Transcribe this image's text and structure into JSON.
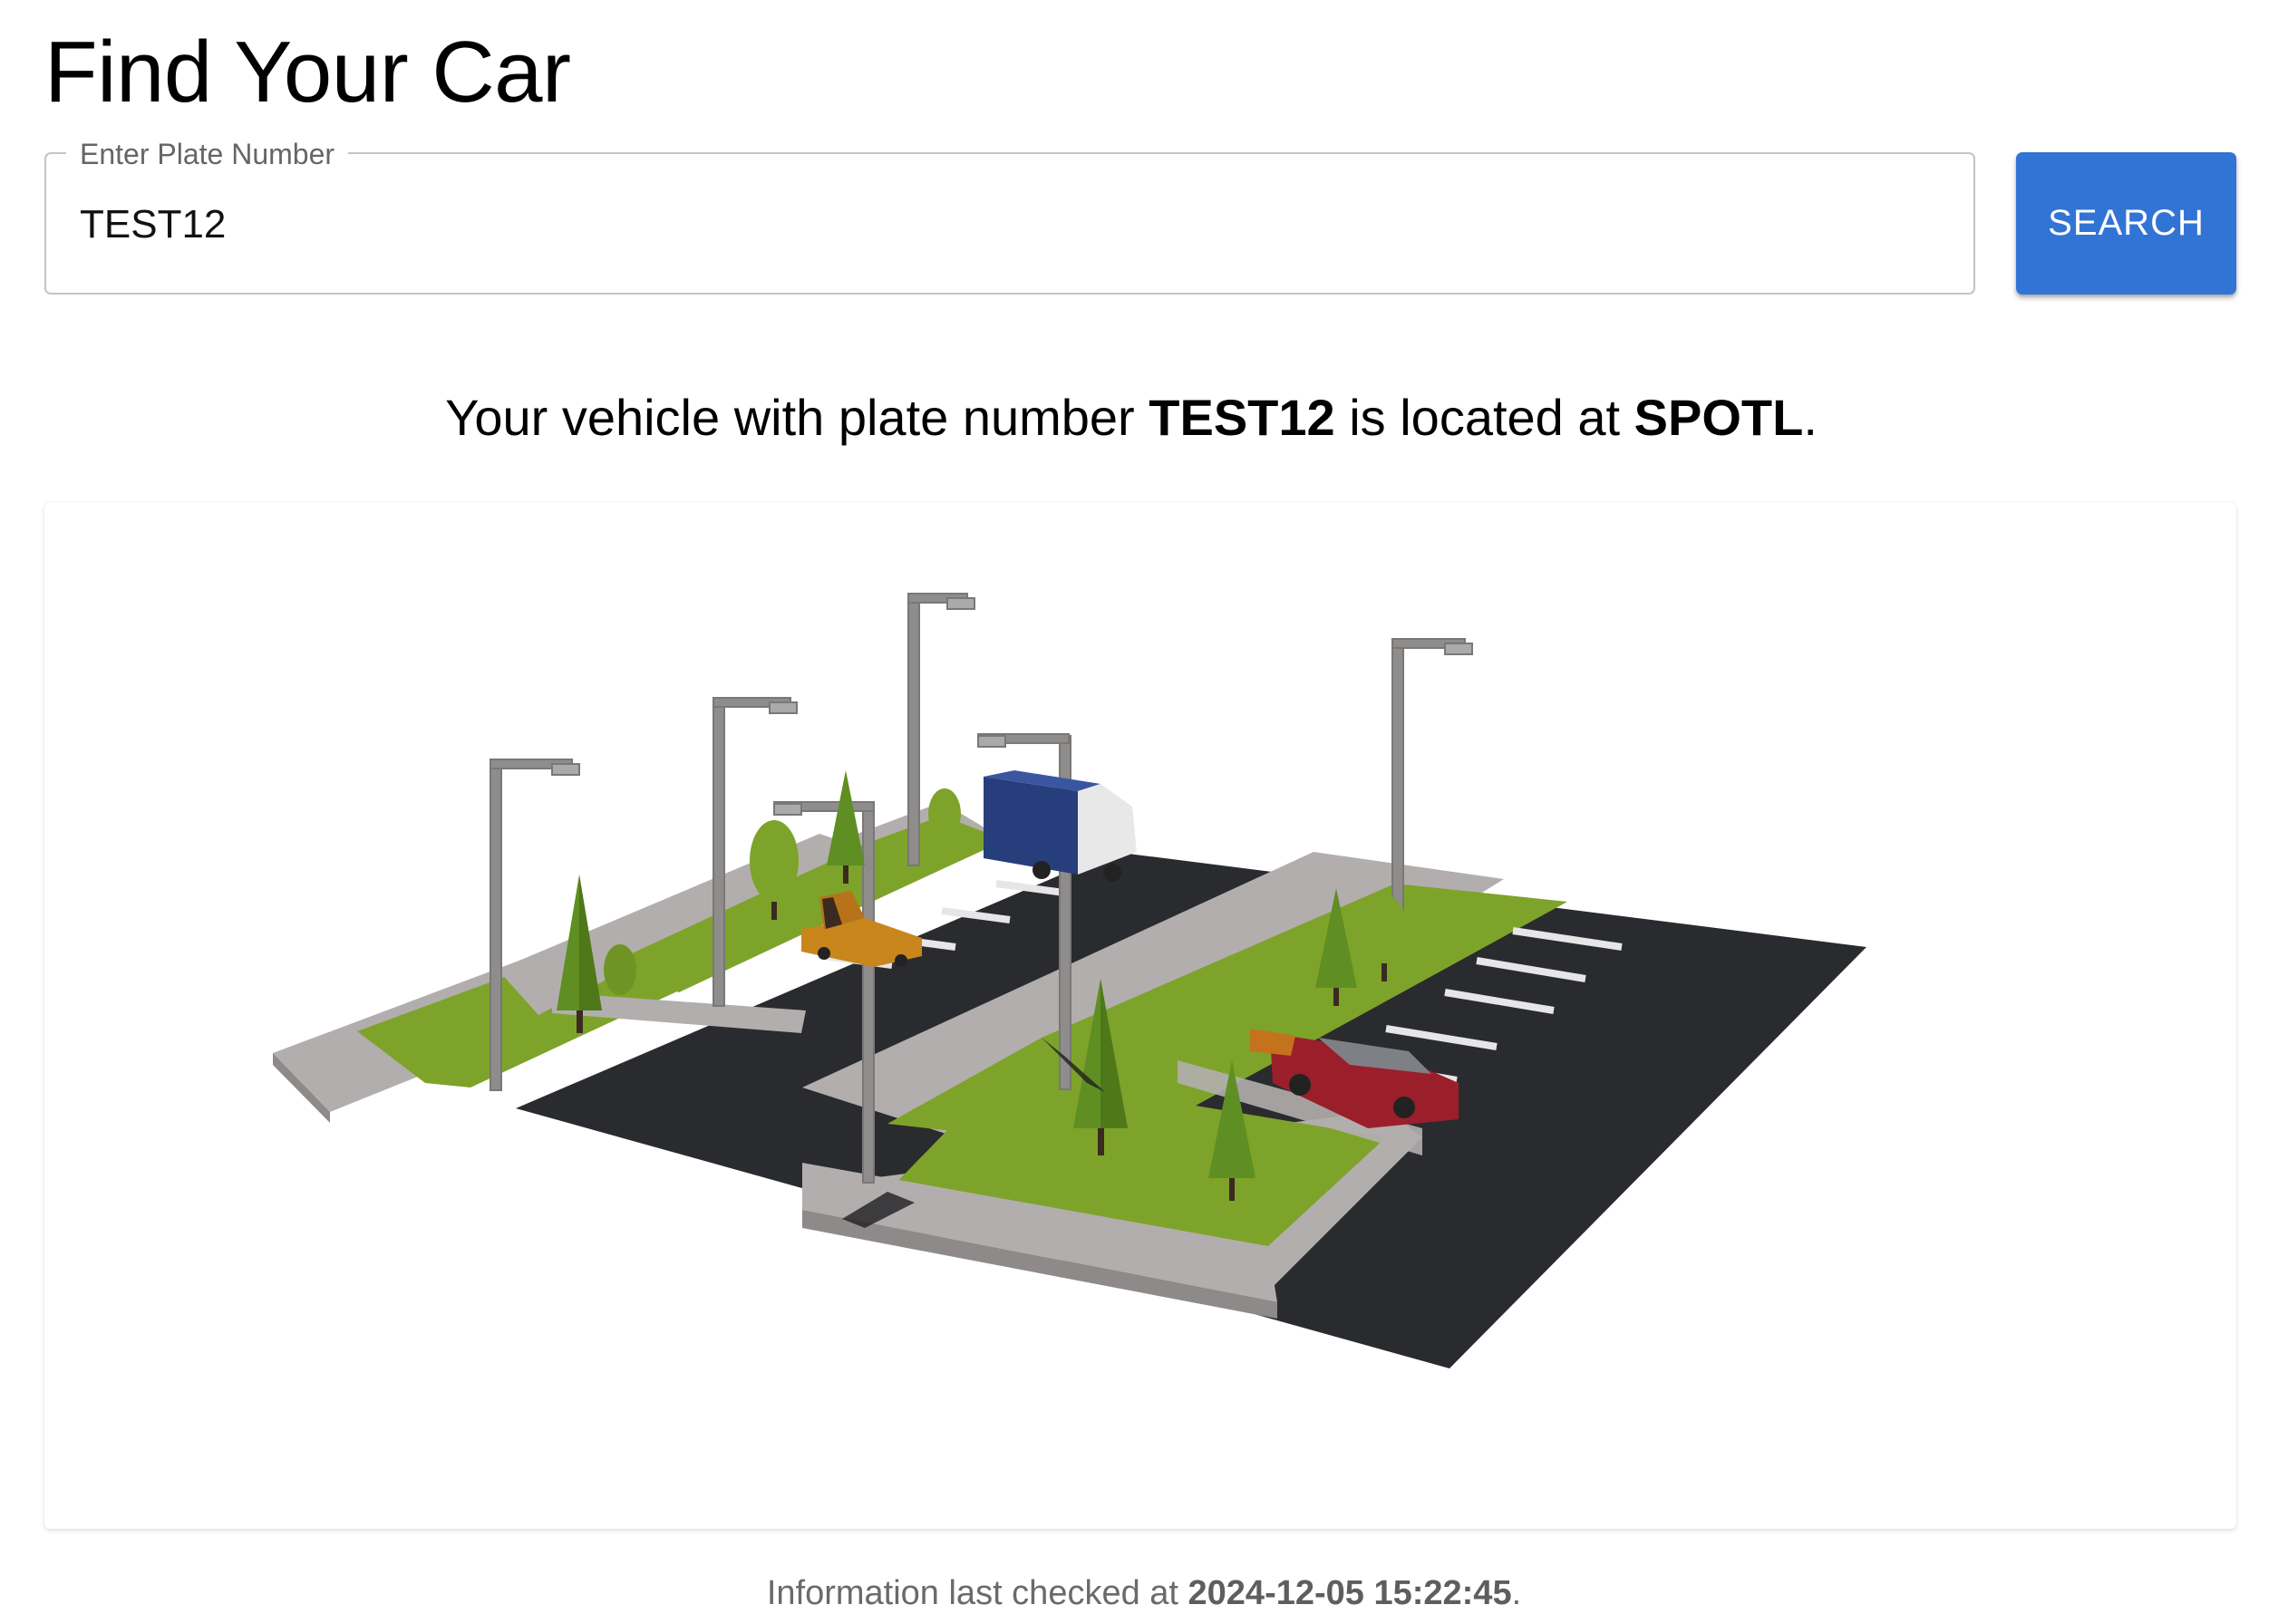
{
  "page": {
    "title": "Find Your Car"
  },
  "search": {
    "label": "Enter Plate Number",
    "value": "TEST12",
    "button_label": "SEARCH"
  },
  "result": {
    "prefix": "Your vehicle with plate number ",
    "plate": "TEST12",
    "middle": " is located at ",
    "spot": "SPOTL",
    "suffix": "."
  },
  "footer": {
    "prefix": "Information last checked at ",
    "timestamp": "2024-12-05 15:22:45",
    "suffix": "."
  },
  "colors": {
    "accent": "#3274d6",
    "asphalt": "#2a2b2e",
    "grass": "#7ea32a",
    "sidewalk": "#b2aeae",
    "car_highlight": "#9a1f2b"
  }
}
